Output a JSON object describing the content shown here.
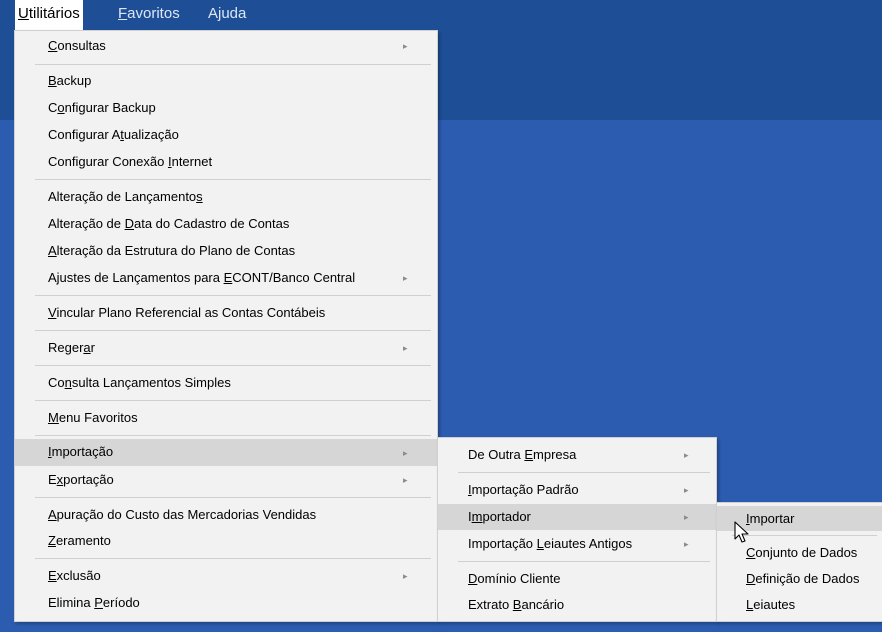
{
  "menubar": {
    "utilitarios": {
      "p1": "",
      "u": "U",
      "p2": "tilitários"
    },
    "favoritos": {
      "p1": "",
      "u": "F",
      "p2": "avoritos"
    },
    "ajuda": {
      "p1": "Ajuda",
      "u": "",
      "p2": ""
    }
  },
  "menu": {
    "consultas": {
      "p1": "",
      "u": "C",
      "p2": "onsultas"
    },
    "backup": {
      "p1": "",
      "u": "B",
      "p2": "ackup"
    },
    "configurar_backup": {
      "p1": "C",
      "u": "o",
      "p2": "nfigurar Backup"
    },
    "configurar_atualizacao": {
      "p1": "Configurar A",
      "u": "t",
      "p2": "ualização"
    },
    "configurar_conexao": {
      "p1": "Configurar Conexão ",
      "u": "I",
      "p2": "nternet"
    },
    "alteracao_lancamentos": {
      "p1": "Alteração de Lançamento",
      "u": "s",
      "p2": ""
    },
    "alteracao_data": {
      "p1": "Alteração de ",
      "u": "D",
      "p2": "ata do Cadastro de Contas"
    },
    "alteracao_estrutura": {
      "p1": "",
      "u": "A",
      "p2": "lteração da Estrutura do Plano de Contas"
    },
    "ajustes_lancamentos": {
      "p1": "Ajustes de Lançamentos para ",
      "u": "E",
      "p2": "CONT/Banco Central"
    },
    "vincular_plano": {
      "p1": "",
      "u": "V",
      "p2": "incular Plano Referencial as Contas Contábeis"
    },
    "regerar": {
      "p1": "Reger",
      "u": "a",
      "p2": "r"
    },
    "consulta_lancamentos": {
      "p1": "Co",
      "u": "n",
      "p2": "sulta Lançamentos Simples"
    },
    "menu_favoritos": {
      "p1": "",
      "u": "M",
      "p2": "enu Favoritos"
    },
    "importacao": {
      "p1": "",
      "u": "I",
      "p2": "mportação"
    },
    "exportacao": {
      "p1": "E",
      "u": "x",
      "p2": "portação"
    },
    "apuracao": {
      "p1": "",
      "u": "A",
      "p2": "puração do Custo das Mercadorias Vendidas"
    },
    "zeramento": {
      "p1": "",
      "u": "Z",
      "p2": "eramento"
    },
    "exclusao": {
      "p1": "",
      "u": "E",
      "p2": "xclusão"
    },
    "elimina_periodo": {
      "p1": "Elimina ",
      "u": "P",
      "p2": "eríodo"
    }
  },
  "submenu_importacao": {
    "de_outra_empresa": {
      "p1": "De Outra ",
      "u": "E",
      "p2": "mpresa"
    },
    "importacao_padrao": {
      "p1": "",
      "u": "I",
      "p2": "mportação Padrão"
    },
    "importador": {
      "p1": "I",
      "u": "m",
      "p2": "portador"
    },
    "importacao_leiautes": {
      "p1": "Importação ",
      "u": "L",
      "p2": "eiautes Antigos"
    },
    "dominio_cliente": {
      "p1": "",
      "u": "D",
      "p2": "omínio Cliente"
    },
    "extrato_bancario": {
      "p1": "Extrato ",
      "u": "B",
      "p2": "ancário"
    }
  },
  "submenu_importador": {
    "importar": {
      "p1": "",
      "u": "I",
      "p2": "mportar"
    },
    "conjunto_dados": {
      "p1": "",
      "u": "C",
      "p2": "onjunto de Dados"
    },
    "definicao_dados": {
      "p1": "",
      "u": "D",
      "p2": "efinição de Dados"
    },
    "leiautes": {
      "p1": "",
      "u": "L",
      "p2": "eiautes"
    }
  },
  "icons": {
    "submenu_arrow": "▸",
    "cursor": "arrow-pointer"
  },
  "colors": {
    "menubar": "#1e4f96",
    "desktop": "#2c5cb0",
    "menu_bg": "#f2f2f2",
    "highlight": "#d6d6d6"
  }
}
